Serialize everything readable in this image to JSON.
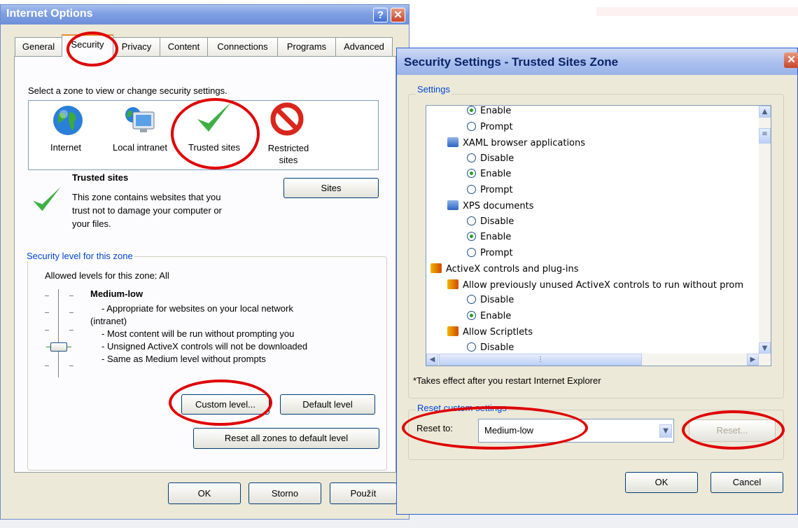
{
  "internet_options": {
    "title": "Internet Options",
    "help_glyph": "?",
    "close_glyph": "✕",
    "tabs": [
      "General",
      "Security",
      "Privacy",
      "Content",
      "Connections",
      "Programs",
      "Advanced"
    ],
    "zone_prompt": "Select a zone to view or change security settings.",
    "zones": [
      {
        "label": "Internet",
        "icon": "globe-icon"
      },
      {
        "label": "Local intranet",
        "icon": "monitor-icon"
      },
      {
        "label": "Trusted sites",
        "icon": "checkmark-icon"
      },
      {
        "label": "Restricted sites",
        "icon": "no-entry-icon"
      }
    ],
    "zone_info_title": "Trusted sites",
    "zone_info_desc": [
      "This zone contains websites that you",
      "trust not to damage your computer or",
      "your files."
    ],
    "sites_button": "Sites",
    "security_level_group": "Security level for this zone",
    "allowed_levels": "Allowed levels for this zone: All",
    "level_name": "Medium-low",
    "level_desc": [
      "- Appropriate for websites on your local network",
      "(intranet)",
      "- Most content will be run without prompting you",
      "- Unsigned ActiveX controls will not be downloaded",
      "- Same as Medium level without prompts"
    ],
    "custom_level_button": "Custom level...",
    "default_level_button": "Default level",
    "reset_all_button": "Reset all zones to default level",
    "ok_button": "OK",
    "cancel_button": "Storno",
    "apply_button": "Použít"
  },
  "security_settings": {
    "title": "Security Settings - Trusted Sites Zone",
    "close_glyph": "✕",
    "settings_group": "Settings",
    "list_rows": [
      {
        "kind": "radio",
        "label": "Enable",
        "checked": true,
        "indent": 1
      },
      {
        "kind": "radio",
        "label": "Prompt",
        "checked": false,
        "indent": 1
      },
      {
        "kind": "item",
        "label": "XAML browser applications",
        "icon": "settings-icon",
        "indent": 0
      },
      {
        "kind": "radio",
        "label": "Disable",
        "checked": false,
        "indent": 1
      },
      {
        "kind": "radio",
        "label": "Enable",
        "checked": true,
        "indent": 1
      },
      {
        "kind": "radio",
        "label": "Prompt",
        "checked": false,
        "indent": 1
      },
      {
        "kind": "item",
        "label": "XPS documents",
        "icon": "settings-icon",
        "indent": 0
      },
      {
        "kind": "radio",
        "label": "Disable",
        "checked": false,
        "indent": 1
      },
      {
        "kind": "radio",
        "label": "Enable",
        "checked": true,
        "indent": 1
      },
      {
        "kind": "radio",
        "label": "Prompt",
        "checked": false,
        "indent": 1
      },
      {
        "kind": "item",
        "label": "ActiveX controls and plug-ins",
        "icon": "shield-icon",
        "indent": -1
      },
      {
        "kind": "item",
        "label": "Allow previously unused ActiveX controls to run without prom",
        "icon": "shield-icon",
        "indent": 0
      },
      {
        "kind": "radio",
        "label": "Disable",
        "checked": false,
        "indent": 1
      },
      {
        "kind": "radio",
        "label": "Enable",
        "checked": true,
        "indent": 1
      },
      {
        "kind": "item",
        "label": "Allow Scriptlets",
        "icon": "shield-icon",
        "indent": 0
      },
      {
        "kind": "radio",
        "label": "Disable",
        "checked": false,
        "indent": 1
      }
    ],
    "restart_note": "*Takes effect after you restart Internet Explorer",
    "reset_group": "Reset custom settings",
    "reset_to_label": "Reset to:",
    "reset_to_value": "Medium-low",
    "reset_button": "Reset...",
    "ok_button": "OK",
    "cancel_button": "Cancel"
  },
  "colors": {
    "annotation": "#e00000",
    "xp_blue": "#0046d5",
    "trusted_green": "#3cb043",
    "restricted_red": "#d9261c"
  }
}
